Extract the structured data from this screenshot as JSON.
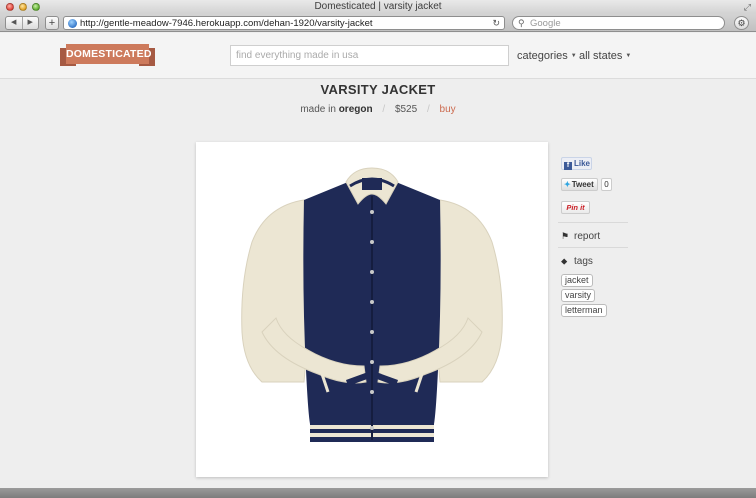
{
  "window": {
    "title": "Domesticated | varsity jacket"
  },
  "toolbar": {
    "back_glyph": "◀",
    "forward_glyph": "▶",
    "add_glyph": "+",
    "url": "http://gentle-meadow-7946.herokuapp.com/dehan-1920/varsity-jacket",
    "search_placeholder": "Google"
  },
  "site": {
    "logo_text": "DOMESTICATED",
    "search_placeholder": "find everything made in usa",
    "nav": {
      "categories": "categories",
      "states": "all states"
    }
  },
  "product": {
    "title": "VARSITY JACKET",
    "made_in_label": "made in",
    "origin": "oregon",
    "price": "$525",
    "buy": "buy"
  },
  "social": {
    "like": "Like",
    "tweet": "Tweet",
    "tweet_count": "0",
    "pin": "Pin it"
  },
  "sidebar": {
    "report": "report",
    "tags_heading": "tags",
    "tags": [
      "jacket",
      "varsity",
      "letterman"
    ]
  },
  "icons": {
    "globe": "globe-icon",
    "reload": "reload-icon",
    "magnifier": "magnifier-icon",
    "gear": "gear-icon",
    "flag": "flag-icon",
    "tag": "tag-icon"
  },
  "colors": {
    "brand": "#cd7a5c",
    "buy_link": "#cc6b4f",
    "jacket_body": "#1f2a56",
    "jacket_sleeves": "#ece6d3"
  }
}
